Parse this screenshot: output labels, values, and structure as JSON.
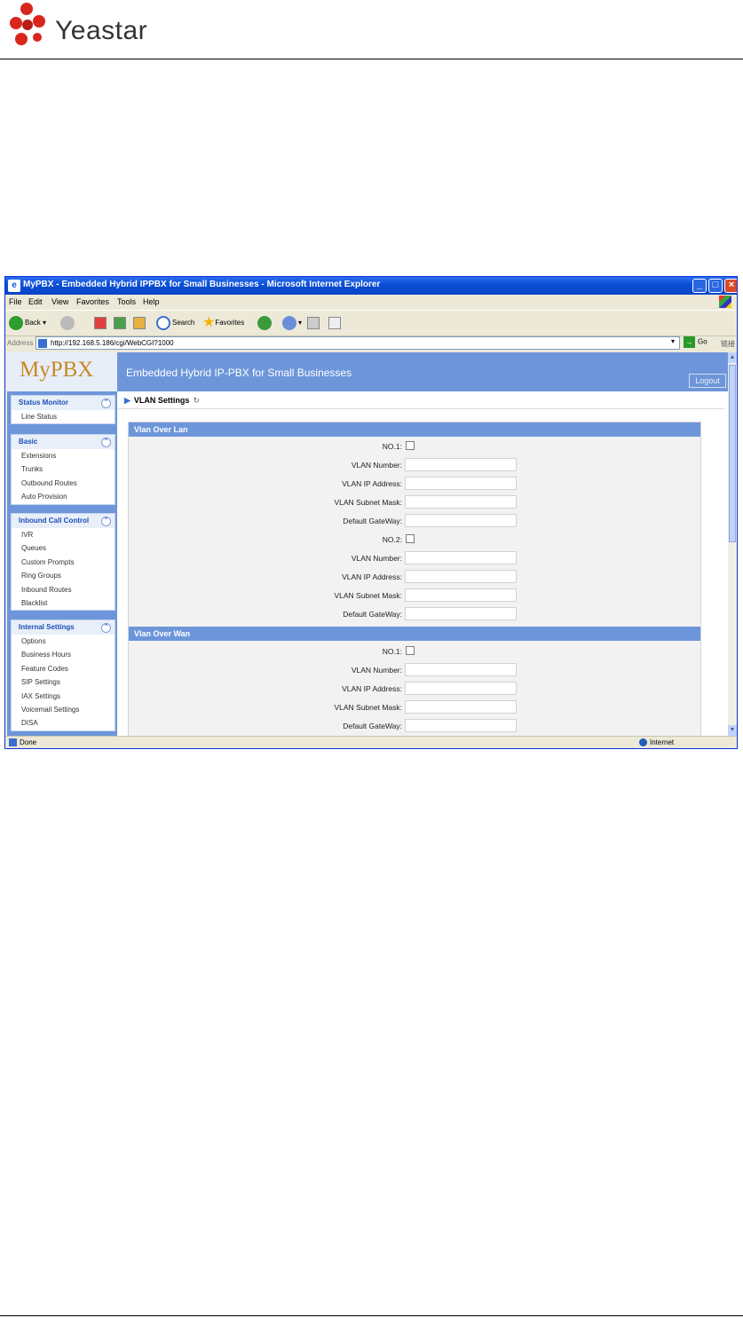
{
  "doc": {
    "brand": "Yeastar"
  },
  "window": {
    "title": "MyPBX - Embedded Hybrid IPPBX for Small Businesses - Microsoft Internet Explorer",
    "menu": [
      "File",
      "Edit",
      "View",
      "Favorites",
      "Tools",
      "Help"
    ],
    "toolbar": {
      "back": "Back",
      "search": "Search",
      "favorites": "Favorites"
    },
    "address_label": "Address",
    "url": "http://192.168.5.186/cgi/WebCGI?1000",
    "go": "Go",
    "links": "链接",
    "status_left": "Done",
    "status_zone": "Internet"
  },
  "app": {
    "brand": "MyPBX",
    "banner_title": "Embedded Hybrid IP-PBX for Small Businesses",
    "logout": "Logout",
    "breadcrumb": "VLAN Settings",
    "sidebar": [
      {
        "title": "Status Monitor",
        "items": [
          "Line Status"
        ]
      },
      {
        "title": "Basic",
        "items": [
          "Extensions",
          "Trunks",
          "Outbound Routes",
          "Auto Provision"
        ]
      },
      {
        "title": "Inbound Call Control",
        "items": [
          "IVR",
          "Queues",
          "Custom Prompts",
          "Ring Groups",
          "Inbound Routes",
          "Blacklist"
        ]
      },
      {
        "title": "Internal Settings",
        "items": [
          "Options",
          "Business Hours",
          "Feature Codes",
          "SIP Settings",
          "IAX Settings",
          "Voicemail Settings",
          "DISA"
        ]
      }
    ],
    "sections": [
      {
        "title": "Vlan Over Lan",
        "rows": [
          {
            "label": "NO.1:",
            "type": "checkbox",
            "checked": false
          },
          {
            "label": "VLAN Number:",
            "type": "text",
            "value": ""
          },
          {
            "label": "VLAN IP Address:",
            "type": "text",
            "value": ""
          },
          {
            "label": "VLAN Subnet Mask:",
            "type": "text",
            "value": ""
          },
          {
            "label": "Default GateWay:",
            "type": "text",
            "value": ""
          },
          {
            "label": "NO.2:",
            "type": "checkbox",
            "checked": false
          },
          {
            "label": "VLAN Number:",
            "type": "text",
            "value": ""
          },
          {
            "label": "VLAN IP Address:",
            "type": "text",
            "value": ""
          },
          {
            "label": "VLAN Subnet Mask:",
            "type": "text",
            "value": ""
          },
          {
            "label": "Default GateWay:",
            "type": "text",
            "value": ""
          }
        ]
      },
      {
        "title": "Vlan Over Wan",
        "rows": [
          {
            "label": "NO.1:",
            "type": "checkbox",
            "checked": false
          },
          {
            "label": "VLAN Number:",
            "type": "text",
            "value": ""
          },
          {
            "label": "VLAN IP Address:",
            "type": "text",
            "value": ""
          },
          {
            "label": "VLAN Subnet Mask:",
            "type": "text",
            "value": ""
          },
          {
            "label": "Default GateWay:",
            "type": "text",
            "value": ""
          }
        ]
      }
    ]
  }
}
